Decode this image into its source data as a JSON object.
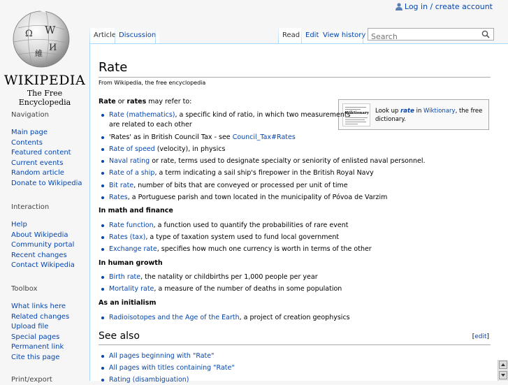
{
  "personal": {
    "login_label": "Log in / create account"
  },
  "logo": {
    "wordmark": "Wikipedia",
    "tagline": "The Free Encyclopedia",
    "globe_glyphs": [
      "Ω",
      "W",
      "И",
      "維"
    ]
  },
  "sidebar": {
    "navigation": {
      "heading": "Navigation",
      "items": [
        "Main page",
        "Contents",
        "Featured content",
        "Current events",
        "Random article",
        "Donate to Wikipedia"
      ]
    },
    "interaction": {
      "heading": "Interaction",
      "items": [
        "Help",
        "About Wikipedia",
        "Community portal",
        "Recent changes",
        "Contact Wikipedia"
      ]
    },
    "toolbox": {
      "heading": "Toolbox",
      "items": [
        "What links here",
        "Related changes",
        "Upload file",
        "Special pages",
        "Permanent link",
        "Cite this page"
      ]
    },
    "print_export": {
      "heading": "Print/export"
    }
  },
  "tabs": {
    "article": "Article",
    "discussion": "Discussion",
    "read": "Read",
    "edit": "Edit",
    "history": "View history"
  },
  "search": {
    "placeholder": "Search"
  },
  "page": {
    "title": "Rate",
    "site_sub": "From Wikipedia, the free encyclopedia",
    "intro": {
      "bold1": "Rate",
      "mid": " or ",
      "bold2": "rates",
      "rest": " may refer to:"
    },
    "items_main": [
      {
        "link": "Rate (mathematics)",
        "text": ", a specific kind of ratio, in which two measurements"
      },
      {
        "link": "",
        "text": "'Rates' as in British Council Tax - see ",
        "link2": "Council_Tax#Rates"
      },
      {
        "link": "Rate of speed",
        "text": " (velocity), in physics"
      },
      {
        "link": "Naval rating",
        "text": " or rate, terms used to designate specialty or seniority of enlisted naval personnel."
      },
      {
        "link": "Rate of a ship",
        "text": ", a term indicating a sail ship's firepower in the British Royal Navy"
      },
      {
        "link": "Bit rate",
        "text": ", number of bits that are conveyed or processed per unit of time"
      },
      {
        "link": "Rates",
        "text": ", a Portuguese parish and town located in the municipality of Póvoa de Varzim"
      }
    ],
    "item1_line2": "are related to each other",
    "section_math": "In math and finance",
    "items_math": [
      {
        "link": "Rate function",
        "text": ", a function used to quantify the probabilities of rare event"
      },
      {
        "link": "Rates (tax)",
        "text": ", a type of taxation system used to fund local government"
      },
      {
        "link": "Exchange rate",
        "text": ", specifies how much one currency is worth in terms of the other"
      }
    ],
    "section_growth": "In human growth",
    "items_growth": [
      {
        "link": "Birth rate",
        "text": ", the natality or childbirths per 1,000 people per year"
      },
      {
        "link": "Mortality rate",
        "text": ", a measure of the number of deaths in some population"
      }
    ],
    "section_initialism": "As an initialism",
    "items_initialism": [
      {
        "link": "Radioisotopes and the Age of the Earth",
        "text": ", a project of creation geophysics"
      }
    ],
    "see_also": {
      "heading": "See also",
      "edit_label": "edit",
      "items": [
        "All pages beginning with \"Rate\"",
        "All pages with titles containing \"Rate\"",
        "Rating (disambiguation)"
      ]
    }
  },
  "wiktionary": {
    "text_pre": "Look up ",
    "term": "rate",
    "text_mid": " in ",
    "site": "Wiktionary",
    "text_post": ", the free dictionary.",
    "thumb_title": "Wiktionary"
  }
}
